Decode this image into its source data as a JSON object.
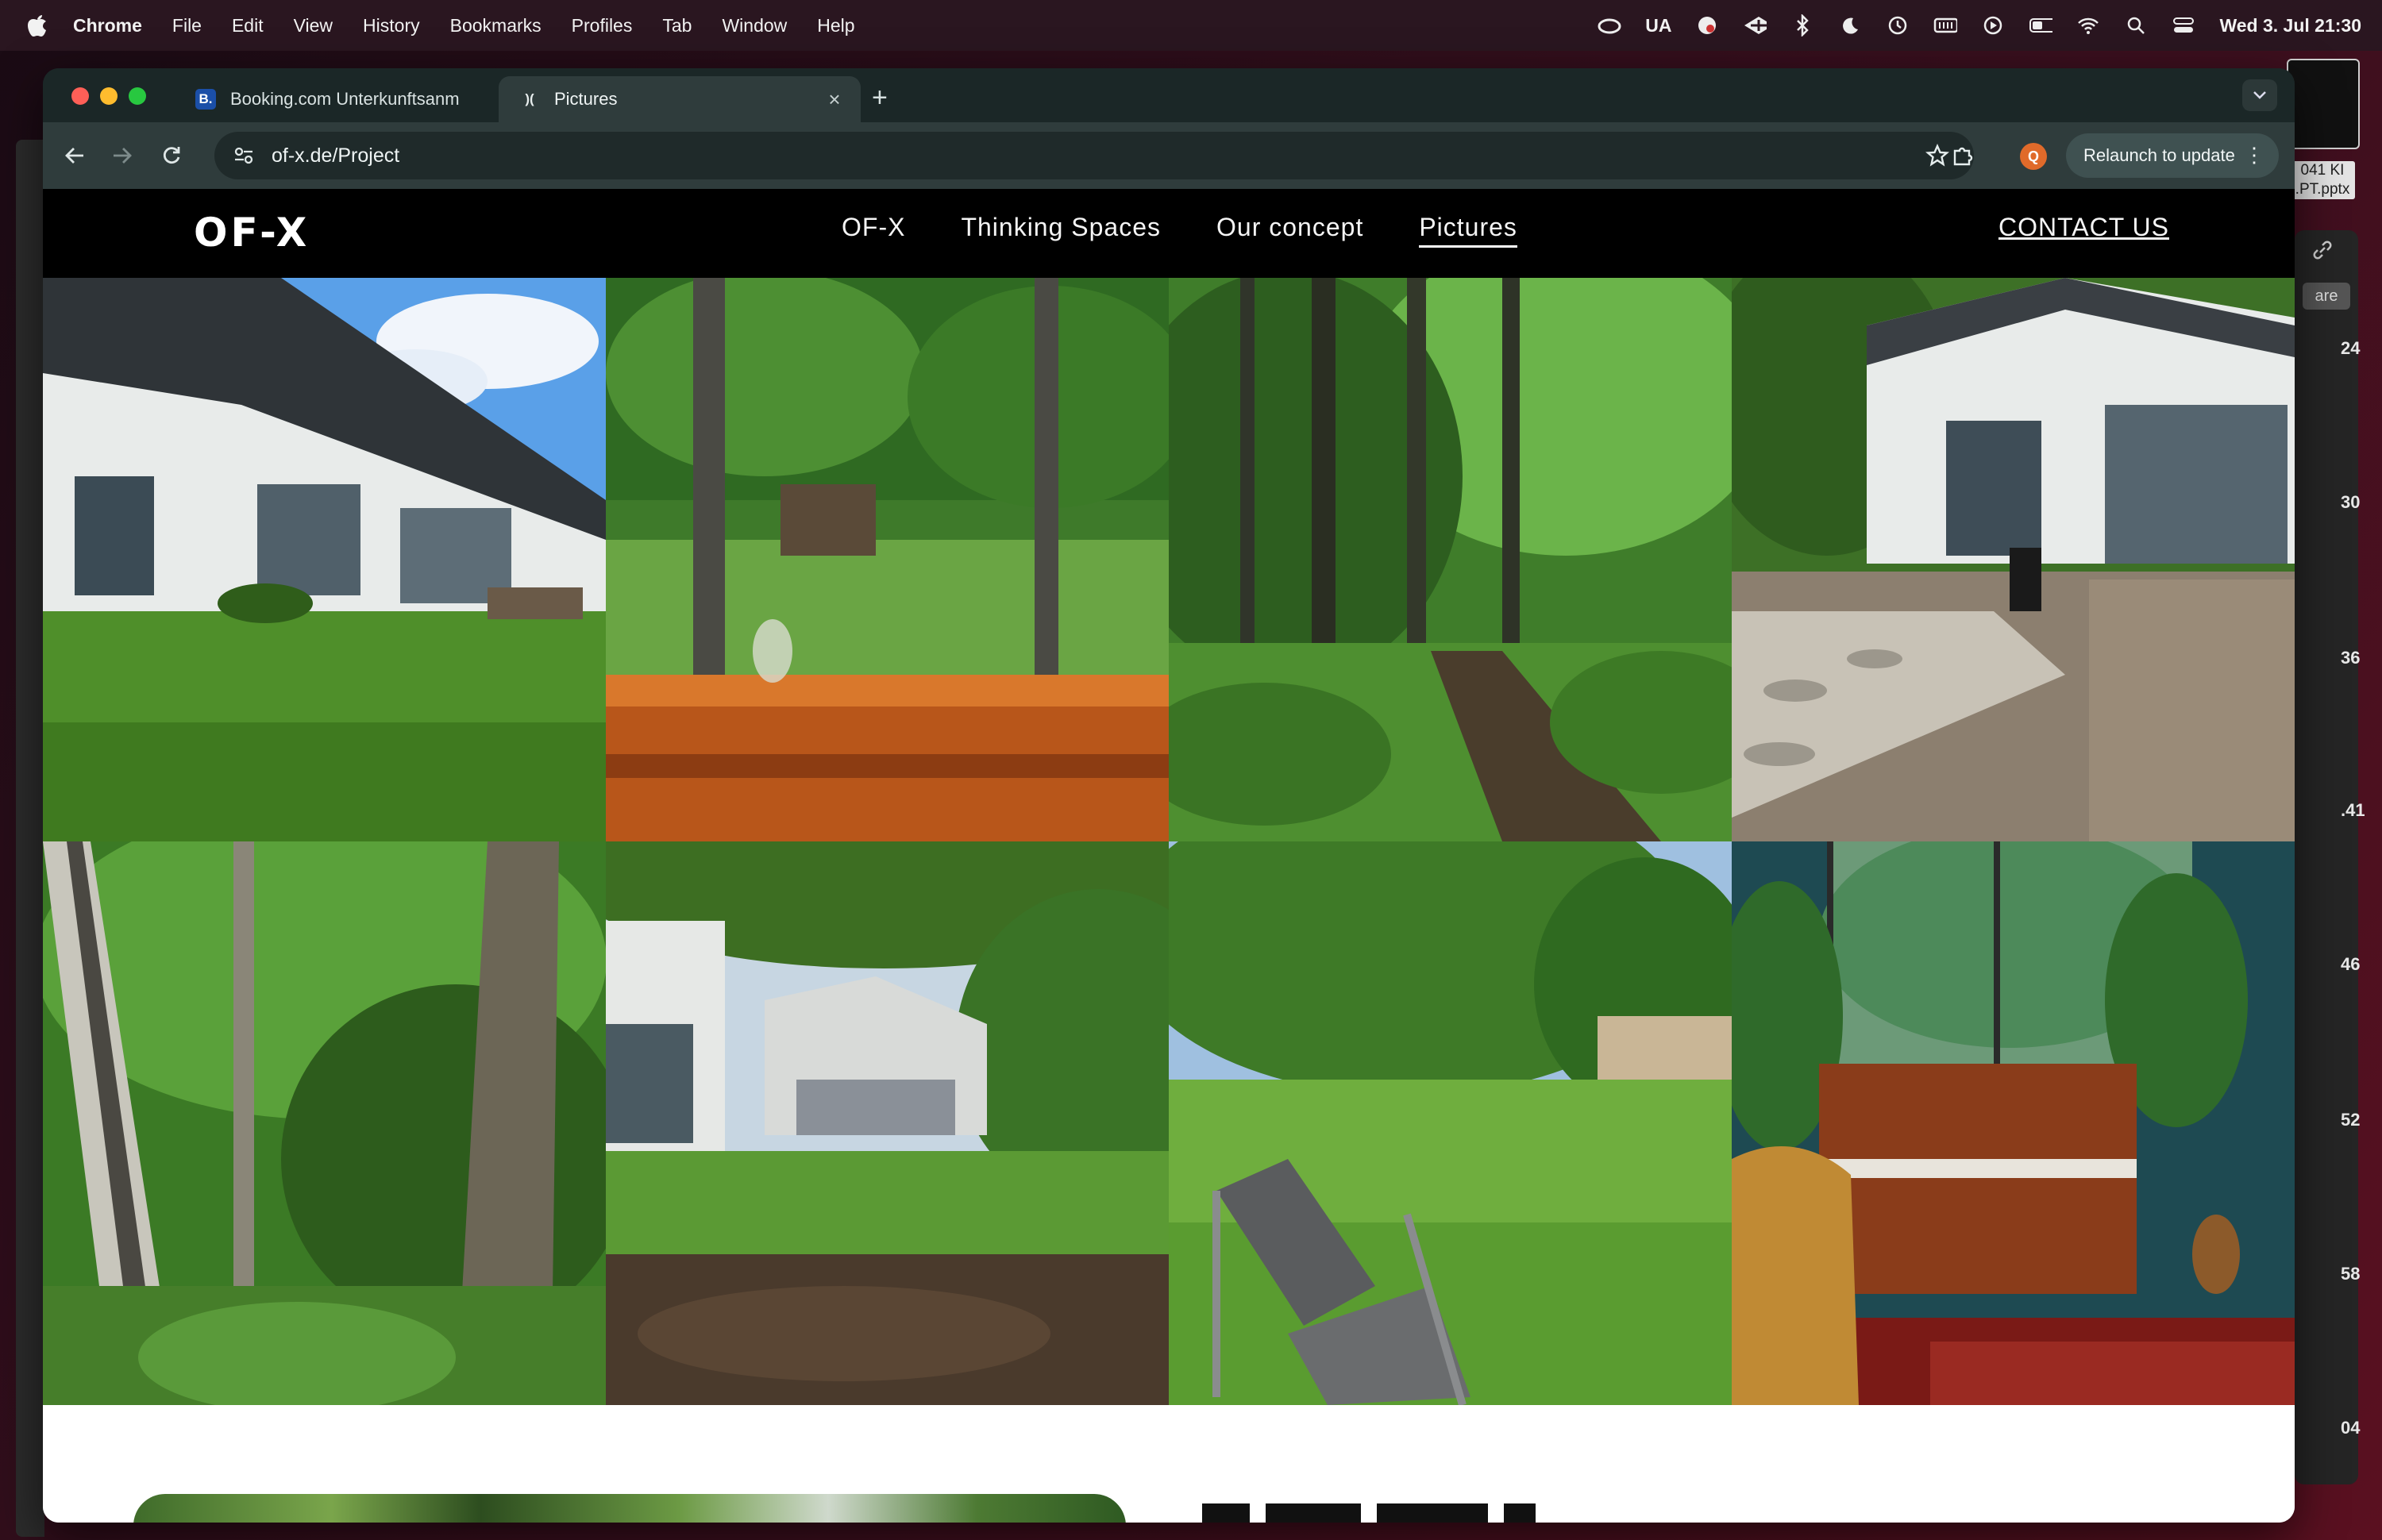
{
  "menubar": {
    "app_name": "Chrome",
    "items": [
      "File",
      "Edit",
      "View",
      "History",
      "Bookmarks",
      "Profiles",
      "Tab",
      "Window",
      "Help"
    ],
    "status_ua": "UA",
    "datetime": "Wed 3. Jul 21:30"
  },
  "desktop": {
    "file_label_1": "041 KI",
    "file_label_2": ".PT.pptx",
    "side_label": "are",
    "side_numbers": [
      "24",
      "30",
      "36",
      ".41",
      "46",
      "52",
      "58",
      "04"
    ]
  },
  "browser": {
    "tabs": [
      {
        "title": "Booking.com Unterkunftsanm",
        "favicon_text": "B."
      },
      {
        "title": "Pictures",
        "favicon_text": ")("
      }
    ],
    "url": "of-x.de/Project",
    "profile_initial": "Q",
    "relaunch_label": "Relaunch to update",
    "colors": {
      "profile": "#e06a2a",
      "tab_active": "#2f3c3c",
      "toolbar": "#2f3c3c"
    }
  },
  "site": {
    "logo": "OF-X",
    "nav": [
      "OF-X",
      "Thinking Spaces",
      "Our concept",
      "Pictures"
    ],
    "active_nav": "Pictures",
    "contact": "CONTACT US"
  }
}
